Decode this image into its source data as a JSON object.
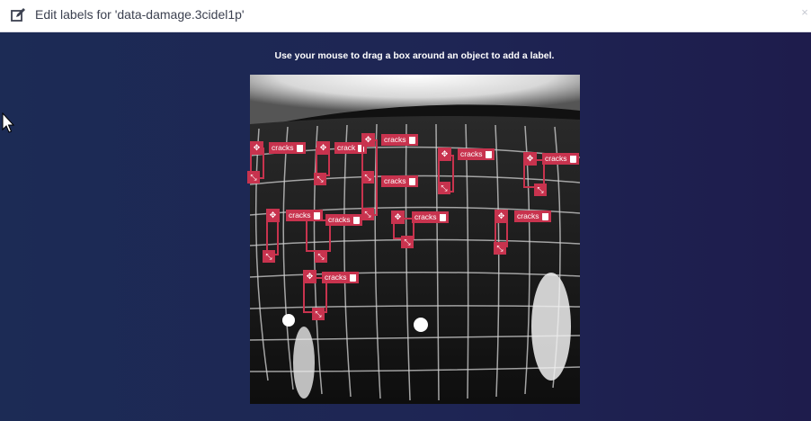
{
  "header": {
    "title": "Edit labels for 'data-damage.3cidel1p'",
    "close_glyph": "×"
  },
  "instructions": "Use your mouse to drag a box around an object to add a label.",
  "labels": [
    {
      "text": "cracks"
    },
    {
      "text": "cracks"
    },
    {
      "text": "crack"
    },
    {
      "text": "cracks"
    },
    {
      "text": "cracks"
    },
    {
      "text": "cracks"
    },
    {
      "text": "cracks"
    },
    {
      "text": "cracks"
    },
    {
      "text": "cracks"
    },
    {
      "text": "cracks"
    },
    {
      "text": "cracks"
    },
    {
      "text": "cracks"
    }
  ],
  "colors": {
    "accent": "#c8334e",
    "background": "#1c2448"
  }
}
